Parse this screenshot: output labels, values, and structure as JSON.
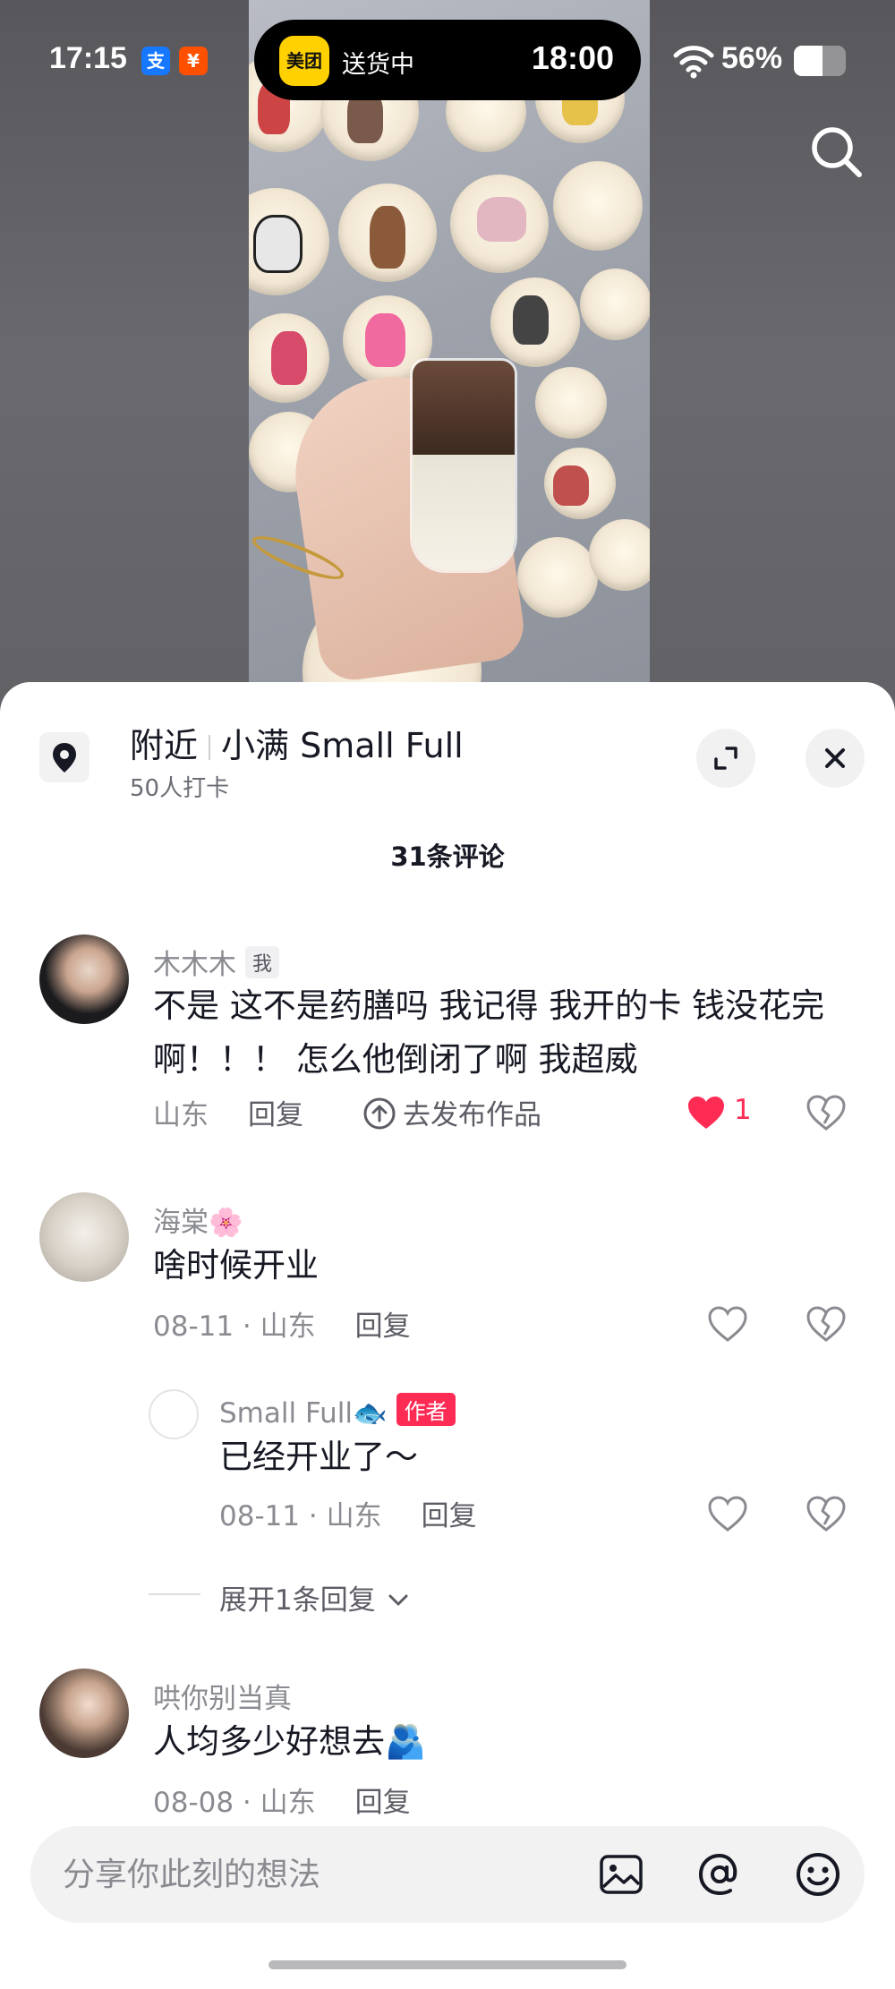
{
  "status_bar": {
    "time": "17:15",
    "app_icons": [
      {
        "name": "alipay-icon",
        "glyph": "支",
        "color": "#1677ff"
      },
      {
        "name": "taobao-icon",
        "glyph": "¥",
        "color": "#ff5000"
      }
    ],
    "island": {
      "logo": "美团",
      "text": "送货中",
      "time": "18:00"
    },
    "battery_percent": "56%",
    "battery_level": 0.56
  },
  "search_icon": "search-icon",
  "sheet": {
    "location": {
      "prefix": "附近",
      "name": "小满 Small Full",
      "checkins": "50人打卡"
    },
    "comment_count": "31条评论",
    "comments": [
      {
        "user": "木木木",
        "badge": "我",
        "text": "不是 这不是药膳吗 我记得 我开的卡 钱没花完啊！！！ 怎么他倒闭了啊 我超威",
        "location": "山东",
        "reply_label": "回复",
        "publish_label": "去发布作品",
        "likes": "1",
        "liked": true
      },
      {
        "user": "海棠🌸",
        "text": "啥时候开业",
        "meta": "08-11 · 山东",
        "reply_label": "回复"
      },
      {
        "user": "Small Full🐟",
        "badge": "作者",
        "text": "已经开业了～",
        "meta": "08-11 · 山东",
        "reply_label": "回复",
        "is_reply": true
      },
      {
        "user": "哄你别当真",
        "text": "人均多少好想去🫂",
        "meta": "08-08 · 山东",
        "reply_label": "回复"
      }
    ],
    "expand_replies": "展开1条回复"
  },
  "input": {
    "placeholder": "分享你此刻的想法"
  },
  "colors": {
    "accent": "#fe2c55",
    "meituan": "#ffd100"
  }
}
